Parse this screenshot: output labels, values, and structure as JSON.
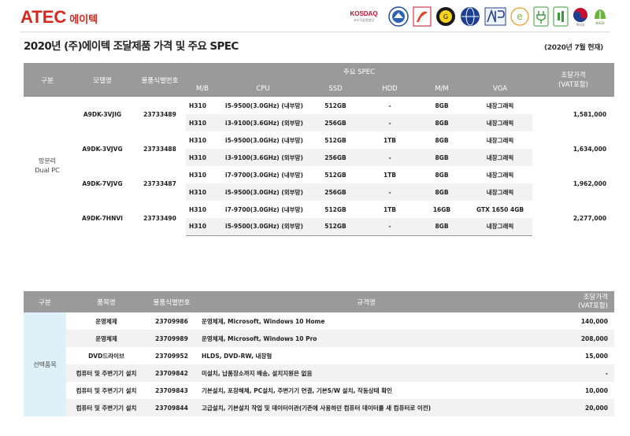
{
  "header": {
    "logo_text": "ATEC",
    "logo_sub": "에이텍",
    "kosdaq_label": "KOSDAQ",
    "kosdaq_sub": "코스닥상장법인",
    "mohw_label": "복지부",
    "badge_last": "NHEB",
    "colors": {
      "brand": "#d7261e",
      "header_bg": "#9a9a9a",
      "category_bg_1": "#efebe0",
      "category_bg_2": "#def0f8",
      "band_bg": "#f2f2f2"
    }
  },
  "doc": {
    "title": "2020년 (주)에이텍 조달제품 가격 및 주요 SPEC",
    "date": "(2020년 7월 현재)"
  },
  "table1": {
    "headers": {
      "category": "구분",
      "model": "모델명",
      "code": "물품식별번호",
      "spec_group": "주요 SPEC",
      "mb": "M/B",
      "cpu": "CPU",
      "ssd": "SSD",
      "hdd": "HDD",
      "mm": "M/M",
      "vga": "VGA",
      "price_line1": "조달가격",
      "price_line2": "(VAT포함)"
    },
    "category_line1": "망분리",
    "category_line2": "Dual PC",
    "groups": [
      {
        "model": "A9DK-3VJIG",
        "code": "23733489",
        "price": "1,581,000",
        "rows": [
          {
            "mb": "H310",
            "cpu": "i5-9500(3.0GHz) (내부망)",
            "ssd": "512GB",
            "hdd": "-",
            "mm": "8GB",
            "vga": "내장그래픽"
          },
          {
            "mb": "H310",
            "cpu": "i3-9100(3.6GHz) (외부망)",
            "ssd": "256GB",
            "hdd": "-",
            "mm": "8GB",
            "vga": "내장그래픽"
          }
        ]
      },
      {
        "model": "A9DK-3VJVG",
        "code": "23733488",
        "price": "1,634,000",
        "rows": [
          {
            "mb": "H310",
            "cpu": "i5-9500(3.0GHz) (내부망)",
            "ssd": "512GB",
            "hdd": "1TB",
            "mm": "8GB",
            "vga": "내장그래픽"
          },
          {
            "mb": "H310",
            "cpu": "i3-9100(3.6GHz) (외부망)",
            "ssd": "256GB",
            "hdd": "-",
            "mm": "8GB",
            "vga": "내장그래픽"
          }
        ]
      },
      {
        "model": "A9DK-7VJVG",
        "code": "23733487",
        "price": "1,962,000",
        "rows": [
          {
            "mb": "H310",
            "cpu": "i7-9700(3.0GHz) (내부망)",
            "ssd": "512GB",
            "hdd": "1TB",
            "mm": "8GB",
            "vga": "내장그래픽"
          },
          {
            "mb": "H310",
            "cpu": "i5-9500(3.0GHz) (외부망)",
            "ssd": "256GB",
            "hdd": "-",
            "mm": "8GB",
            "vga": "내장그래픽"
          }
        ]
      },
      {
        "model": "A9DK-7HNVI",
        "code": "23733490",
        "price": "2,277,000",
        "rows": [
          {
            "mb": "H310",
            "cpu": "i7-9700(3.0GHz) (내부망)",
            "ssd": "512GB",
            "hdd": "1TB",
            "mm": "16GB",
            "vga": "GTX 1650 4GB"
          },
          {
            "mb": "H310",
            "cpu": "i5-9500(3.0GHz) (외부망)",
            "ssd": "512GB",
            "hdd": "-",
            "mm": "8GB",
            "vga": "내장그래픽"
          }
        ]
      }
    ]
  },
  "table2": {
    "headers": {
      "category": "구분",
      "name": "품목명",
      "code": "물품식별번호",
      "spec": "규격명",
      "price_line1": "조달가격",
      "price_line2": "(VAT포함)"
    },
    "category": "선택품목",
    "rows": [
      {
        "name": "운영체제",
        "code": "23709986",
        "spec": "운영체제, Microsoft, Windows 10 Home",
        "price": "140,000"
      },
      {
        "name": "운영체제",
        "code": "23709989",
        "spec": "운영체제, Microsoft, Windows 10 Pro",
        "price": "208,000"
      },
      {
        "name": "DVD드라이브",
        "code": "23709952",
        "spec": "HLDS, DVD-RW, 내장형",
        "price": "15,000"
      },
      {
        "name": "컴퓨터 및 주변기기 설치",
        "code": "23709842",
        "spec": "미설치, 납품장소까지 배송, 설치지원은 없음",
        "price": "-"
      },
      {
        "name": "컴퓨터 및 주변기기 설치",
        "code": "23709843",
        "spec": "기본설치, 포장해체, PC설치, 주변기기 연결, 기본S/W 설치, 작동상태 확인",
        "price": "10,000"
      },
      {
        "name": "컴퓨터 및 주변기기 설치",
        "code": "23709844",
        "spec": "고급설치, 기본설치 작업 및 데이터이관(기존에 사용하던 컴퓨터 데이터를 새 컴퓨터로 이전)",
        "price": "20,000"
      }
    ]
  }
}
